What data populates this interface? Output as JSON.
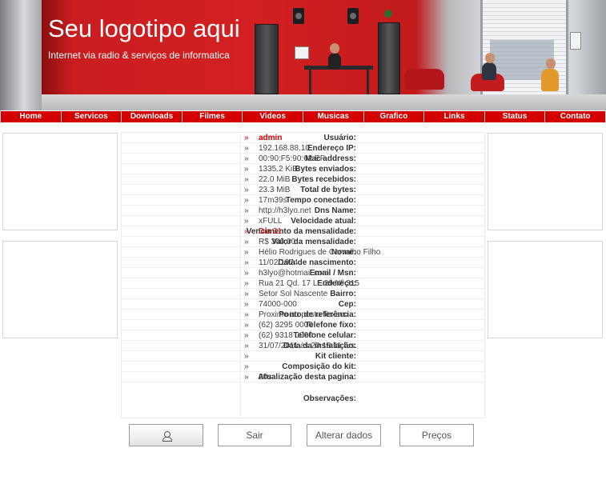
{
  "banner": {
    "title": "Seu logotipo aqui",
    "subtitle": "Internet via radio & serviços de informatica"
  },
  "nav": [
    {
      "label": "Home"
    },
    {
      "label": "Servicos"
    },
    {
      "label": "Downloads"
    },
    {
      "label": "Filmes"
    },
    {
      "label": "Videos"
    },
    {
      "label": "Musicas"
    },
    {
      "label": "Grafico"
    },
    {
      "label": "Links"
    },
    {
      "label": "Status"
    },
    {
      "label": "Contato"
    }
  ],
  "info": {
    "rows": [
      {
        "label": "Usuário:",
        "value": "admin",
        "highlight": true,
        "bold": true
      },
      {
        "label": "Endereço IP:",
        "value": "192.168.88.10"
      },
      {
        "label": "Mac address:",
        "value": "00:90:F5:90:62:EF"
      },
      {
        "label": "Bytes enviados:",
        "value": "1335.2 KiB"
      },
      {
        "label": "Bytes recebidos:",
        "value": "22.0 MiB"
      },
      {
        "label": "Total de bytes:",
        "value": "23.3 MiB"
      },
      {
        "label": "Tempo conectado:",
        "value": "17m39s"
      },
      {
        "label": "Dns Name:",
        "value": "http://h3lyo.net"
      },
      {
        "label": "Velocidade atual:",
        "value": "xFULL"
      },
      {
        "label": "Vencimento da mensalidade:",
        "value": "Dia 31",
        "highlight": true
      },
      {
        "label": "Valor da mensalidade:",
        "value": "R$ 300,00"
      },
      {
        "label": "Nome:",
        "value": "Hélio Rodrigues de Carvalho Filho"
      },
      {
        "label": "Data de nascimento:",
        "value": "11/02/1974"
      },
      {
        "label": "Email / Msn:",
        "value": "h3lyo@hotmail.com"
      },
      {
        "label": "Endereço:",
        "value": "Rua 21 Qd. 17 Lt. 29 Nº 315"
      },
      {
        "label": "Bairro:",
        "value": "Setor Sol Nascente"
      },
      {
        "label": "Cep:",
        "value": "74000-000"
      },
      {
        "label": "Ponto de referência:",
        "value": "Proximo ao posto Texaco"
      },
      {
        "label": "Telefone fixo:",
        "value": "(62) 3295 0000"
      },
      {
        "label": "Telefone celular:",
        "value": "(62) 9318 0000"
      },
      {
        "label": "Data da instalação:",
        "value": "31/07/2011 às 20:18:11 hrs."
      },
      {
        "label": "Kit cliente:",
        "value": ""
      },
      {
        "label": "Composição do kit:",
        "value": ""
      },
      {
        "label": "Atualização desta pagina:",
        "value": "20s"
      }
    ],
    "obs_label": "Observações:",
    "arrow_glyph": "»"
  },
  "buttons": {
    "sair": "Sair",
    "alterar": "Alterar dados",
    "precos": "Preços"
  },
  "colors": {
    "accent": "#d40000",
    "banner_red": "#d32022"
  }
}
